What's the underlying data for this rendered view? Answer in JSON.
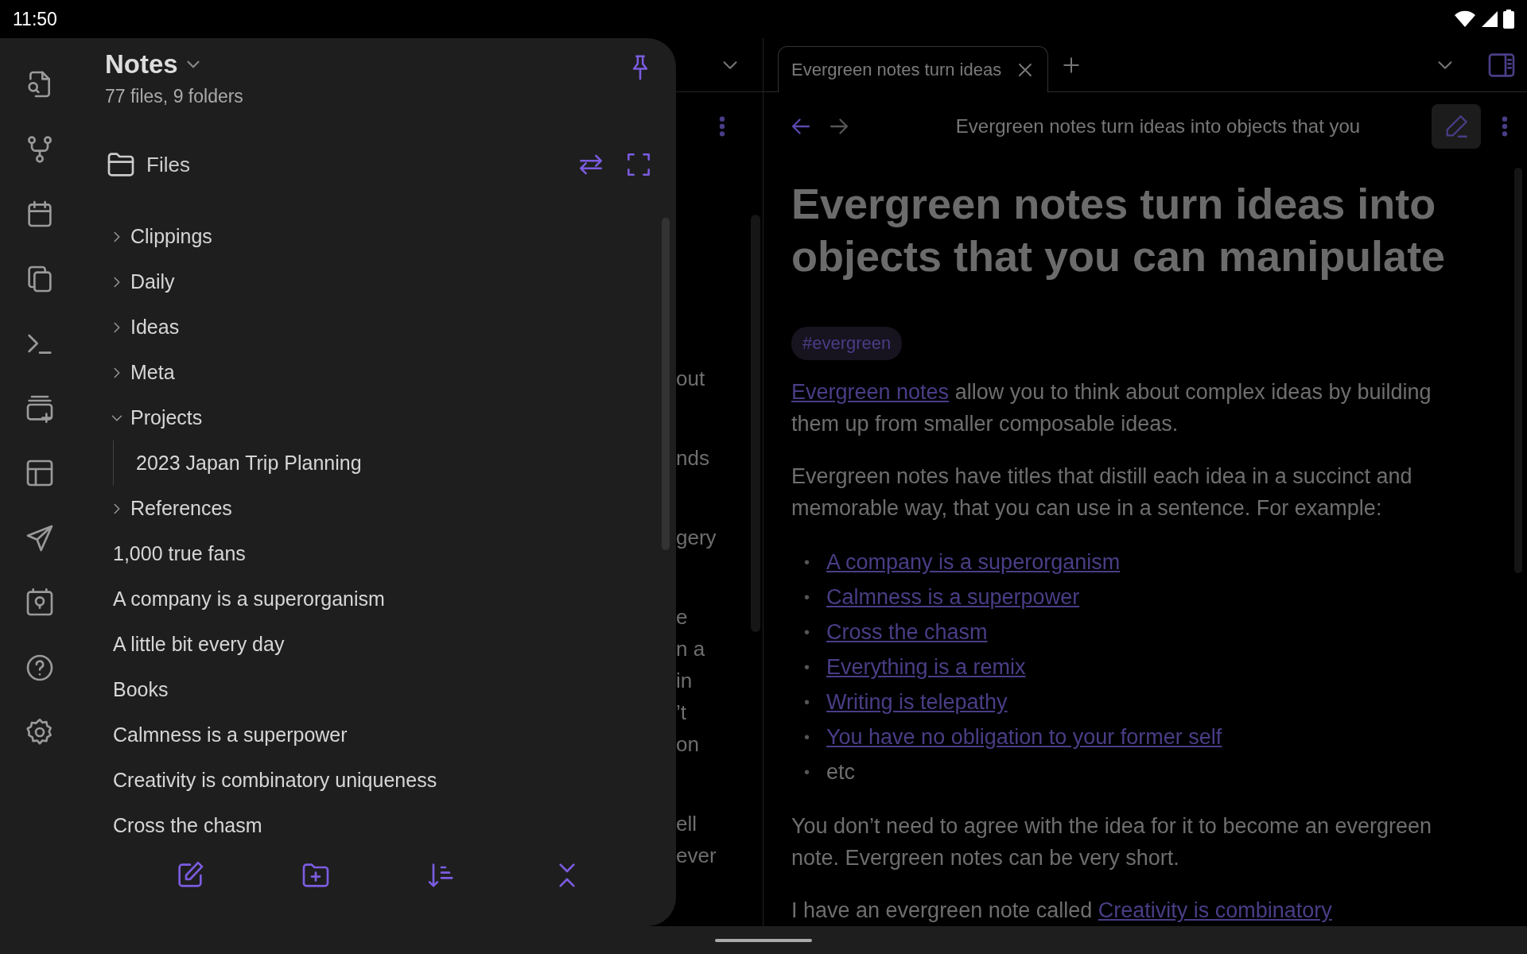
{
  "status_bar": {
    "time": "11:50"
  },
  "drawer": {
    "vault": "Notes",
    "stats": "77 files, 9 folders",
    "panel_title": "Files",
    "tree": [
      {
        "kind": "folder",
        "name": "Clippings",
        "expanded": false
      },
      {
        "kind": "folder",
        "name": "Daily",
        "expanded": false
      },
      {
        "kind": "folder",
        "name": "Ideas",
        "expanded": false
      },
      {
        "kind": "folder",
        "name": "Meta",
        "expanded": false
      },
      {
        "kind": "folder",
        "name": "Projects",
        "expanded": true,
        "children": [
          {
            "kind": "file",
            "name": "2023 Japan Trip Planning"
          }
        ]
      },
      {
        "kind": "folder",
        "name": "References",
        "expanded": false
      },
      {
        "kind": "file",
        "name": "1,000 true fans"
      },
      {
        "kind": "file",
        "name": "A company is a superorganism"
      },
      {
        "kind": "file",
        "name": "A little bit every day"
      },
      {
        "kind": "file",
        "name": "Books"
      },
      {
        "kind": "file",
        "name": "Calmness is a superpower"
      },
      {
        "kind": "file",
        "name": "Creativity is combinatory uniqueness"
      },
      {
        "kind": "file",
        "name": "Cross the chasm"
      }
    ]
  },
  "left_pane": {
    "text_fragments": [
      {
        "lines": [
          "out"
        ]
      },
      {
        "lines": [
          "nds"
        ]
      },
      {
        "lines": [
          "gery"
        ]
      },
      {
        "lines": [
          "e",
          "n a",
          "in",
          "’t",
          "on"
        ]
      },
      {
        "lines": [
          "ell",
          "ever"
        ]
      }
    ]
  },
  "right_pane": {
    "tabs": [
      {
        "title": "Evergreen notes turn ideas",
        "selected": true
      }
    ],
    "nav": {
      "back_enabled": true,
      "forward_enabled": false
    },
    "header_title": "Evergreen notes turn ideas into objects that you",
    "note": {
      "title": "Evergreen notes turn ideas into objects that you can manipulate",
      "tags": [
        "#evergreen"
      ],
      "blocks": [
        {
          "kind": "paragraph",
          "parts": [
            {
              "kind": "link",
              "text": "Evergreen notes"
            },
            {
              "kind": "plain",
              "text": " allow you to think about complex ideas by building them up from smaller composable ideas."
            }
          ]
        },
        {
          "kind": "paragraph",
          "parts": [
            {
              "kind": "plain",
              "text": "Evergreen notes have titles that distill each idea in a succinct and memorable way, that you can use in a sentence. For example:"
            }
          ]
        },
        {
          "kind": "list",
          "items": [
            {
              "marker": "•",
              "parts": [
                {
                  "kind": "link",
                  "text": "A company is a superorganism"
                }
              ]
            },
            {
              "marker": "•",
              "parts": [
                {
                  "kind": "link",
                  "text": "Calmness is a superpower"
                }
              ]
            },
            {
              "marker": "•",
              "parts": [
                {
                  "kind": "link",
                  "text": "Cross the chasm"
                }
              ]
            },
            {
              "marker": "•",
              "parts": [
                {
                  "kind": "link",
                  "text": "Everything is a remix"
                }
              ]
            },
            {
              "marker": "•",
              "parts": [
                {
                  "kind": "link",
                  "text": "Writing is telepathy"
                }
              ]
            },
            {
              "marker": "•",
              "parts": [
                {
                  "kind": "link",
                  "text": "You have no obligation to your former self"
                }
              ]
            },
            {
              "marker": "•",
              "parts": [
                {
                  "kind": "plain",
                  "text": "etc"
                }
              ]
            }
          ]
        },
        {
          "kind": "paragraph",
          "parts": [
            {
              "kind": "plain",
              "text": "You don’t need to agree with the idea for it to become an evergreen note. Evergreen notes can be very short."
            }
          ]
        },
        {
          "kind": "paragraph",
          "parts": [
            {
              "kind": "plain",
              "text": "I have an evergreen note called "
            },
            {
              "kind": "link",
              "text": "Creativity is combinatory"
            }
          ]
        }
      ]
    }
  }
}
